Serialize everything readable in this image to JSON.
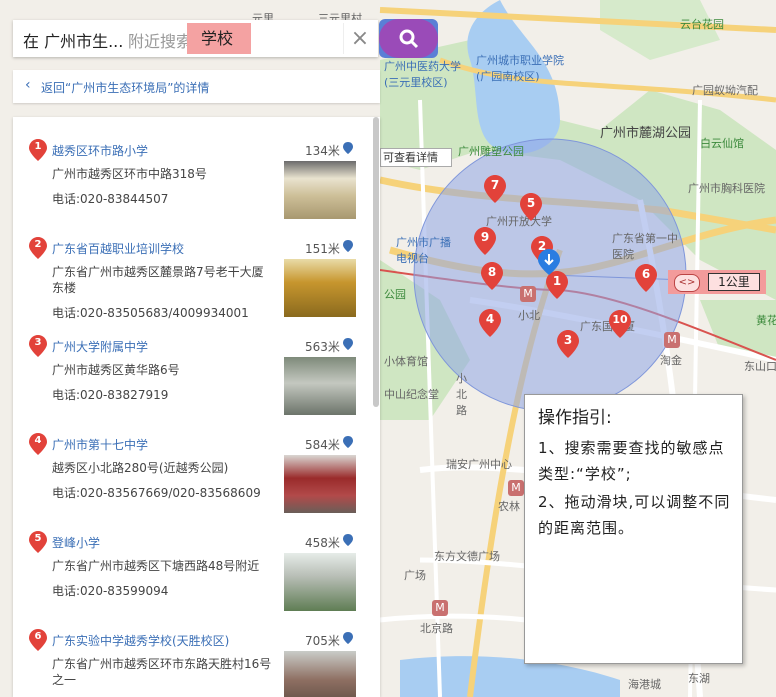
{
  "search": {
    "prefix": "在 广州市生...",
    "placeholder": "附近搜索",
    "value": "学校",
    "clear_icon": "close-icon",
    "search_icon": "search-icon"
  },
  "back_link": {
    "text": "返回“广州市生态环境局”的详情"
  },
  "results": [
    {
      "num": "1",
      "name": "越秀区环市路小学",
      "dist": "134米",
      "addr": "广州市越秀区环市中路318号",
      "tel": "电话:020-83844507"
    },
    {
      "num": "2",
      "name": "广东省百越职业培训学校",
      "dist": "151米",
      "addr": "广东省广州市越秀区麓景路7号老干大厦东楼",
      "tel": "电话:020-83505683/4009934001"
    },
    {
      "num": "3",
      "name": "广州大学附属中学",
      "dist": "563米",
      "addr": "广州市越秀区黄华路6号",
      "tel": "电话:020-83827919"
    },
    {
      "num": "4",
      "name": "广州市第十七中学",
      "dist": "584米",
      "addr": "越秀区小北路280号(近越秀公园)",
      "tel": "电话:020-83567669/020-83568609"
    },
    {
      "num": "5",
      "name": "登峰小学",
      "dist": "458米",
      "addr": "广东省广州市越秀区下塘西路48号附近",
      "tel": "电话:020-83599094"
    },
    {
      "num": "6",
      "name": "广东实验中学越秀学校(天胜校区)",
      "dist": "705米",
      "addr": "广东省广州市越秀区环市东路天胜村16号之一",
      "tel": ""
    }
  ],
  "map": {
    "labels": {
      "yuanli": "元里",
      "sanyuanli": "三元里村",
      "zhongyiyao": "广州中医药大学(三元里校区)",
      "chengshi": "广州城市职业学院(广园南校区)",
      "yuntai": "云台花园",
      "luhu": "广州市麓湖公园",
      "diaosu": "广州雕塑公园",
      "guangyuan": "广园蚁坳汽配",
      "baiyun": "白云仙馆",
      "xiongke": "广州市胸科医院",
      "kaifang": "广州开放大学",
      "guangbo": "广州市广播电视台",
      "gongyuan": "公园",
      "xiaobei": "小北",
      "diyi": "广东省第一中医院",
      "dongguo": "广东国大厦",
      "taojin": "淘金",
      "tiyuguan": "小体育馆",
      "jinian": "中山纪念堂",
      "xiaobeilu": "小北路",
      "ruian": "瑞安广州中心",
      "nonglin": "农林",
      "dongfang": "东方文德广场",
      "guangchang": "广场",
      "beijinglu": "北京路",
      "haiyou": "海港城",
      "dongshanhu": "东湖",
      "huangshi": "黄花",
      "dongshan": "东山口"
    },
    "tip_text": "可查看详情",
    "markers": [
      "1",
      "2",
      "3",
      "4",
      "5",
      "6",
      "7",
      "8",
      "9",
      "10"
    ],
    "scale": {
      "label": "1公里",
      "handle": "<>"
    }
  },
  "guide": {
    "title": "操作指引:",
    "step1": "1、搜索需要查找的敏感点类型:“学校”;",
    "step2": "2、拖动滑块,可以调整不同的距离范围。"
  },
  "colors": {
    "accent": "#3b6fb6",
    "pin": "#e2423a",
    "circle": "#8fa5e6"
  }
}
